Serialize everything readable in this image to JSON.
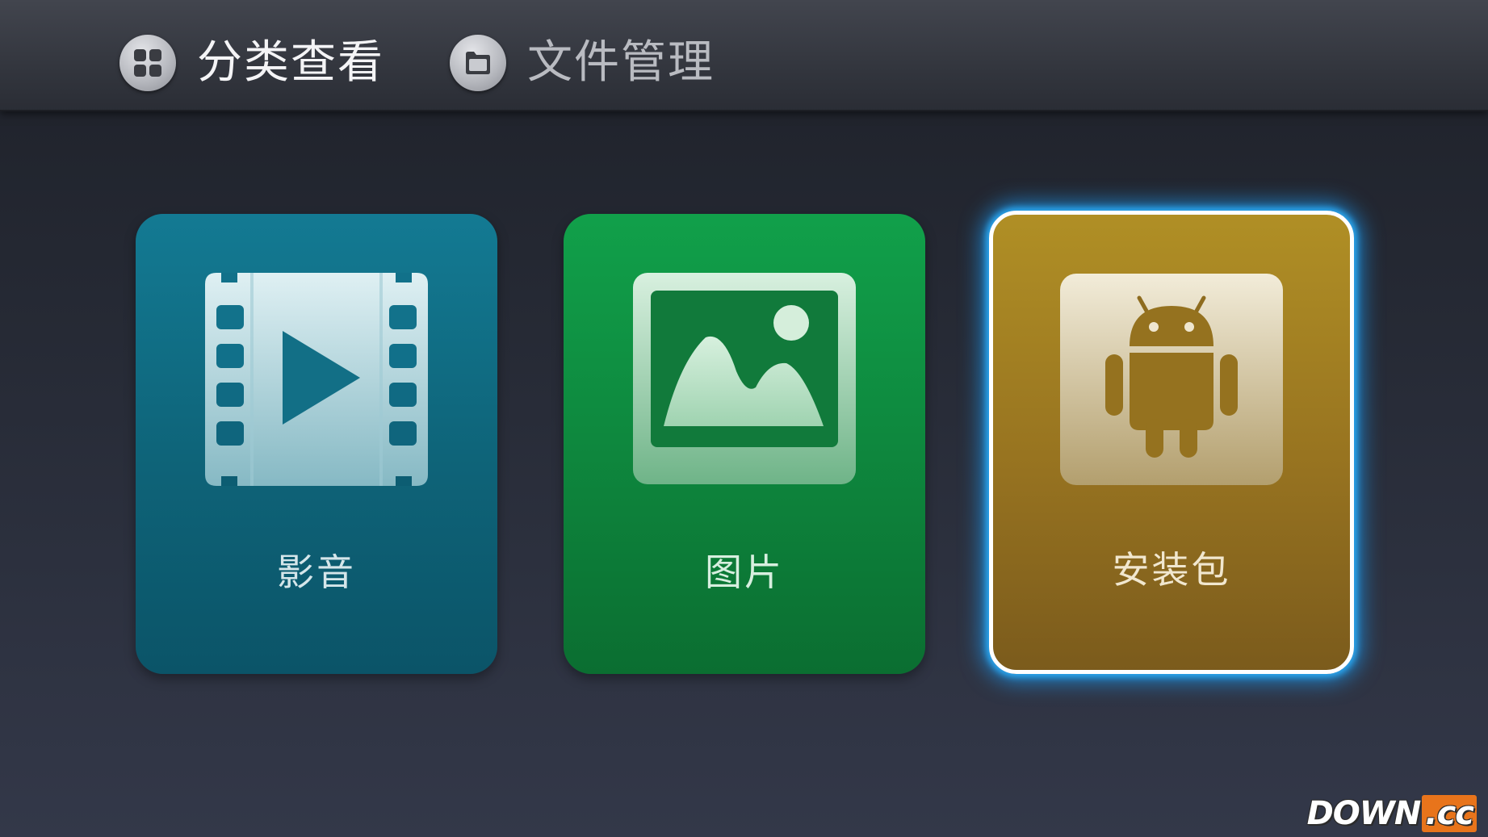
{
  "header": {
    "tabs": [
      {
        "label": "分类查看",
        "icon": "grid-icon",
        "active": true
      },
      {
        "label": "文件管理",
        "icon": "folder-icon",
        "active": false
      }
    ]
  },
  "categories": [
    {
      "label": "影音",
      "icon": "film-play-icon",
      "color": "#0f6b82",
      "focused": false
    },
    {
      "label": "图片",
      "icon": "picture-icon",
      "color": "#0e8a3f",
      "focused": false
    },
    {
      "label": "安装包",
      "icon": "android-icon",
      "color": "#977320",
      "focused": true
    }
  ],
  "colors": {
    "focus_glow": "#2aa7f0",
    "watermark_accent": "#e8741b"
  },
  "watermark": {
    "main": "DOWN",
    "suffix": ".cc"
  }
}
